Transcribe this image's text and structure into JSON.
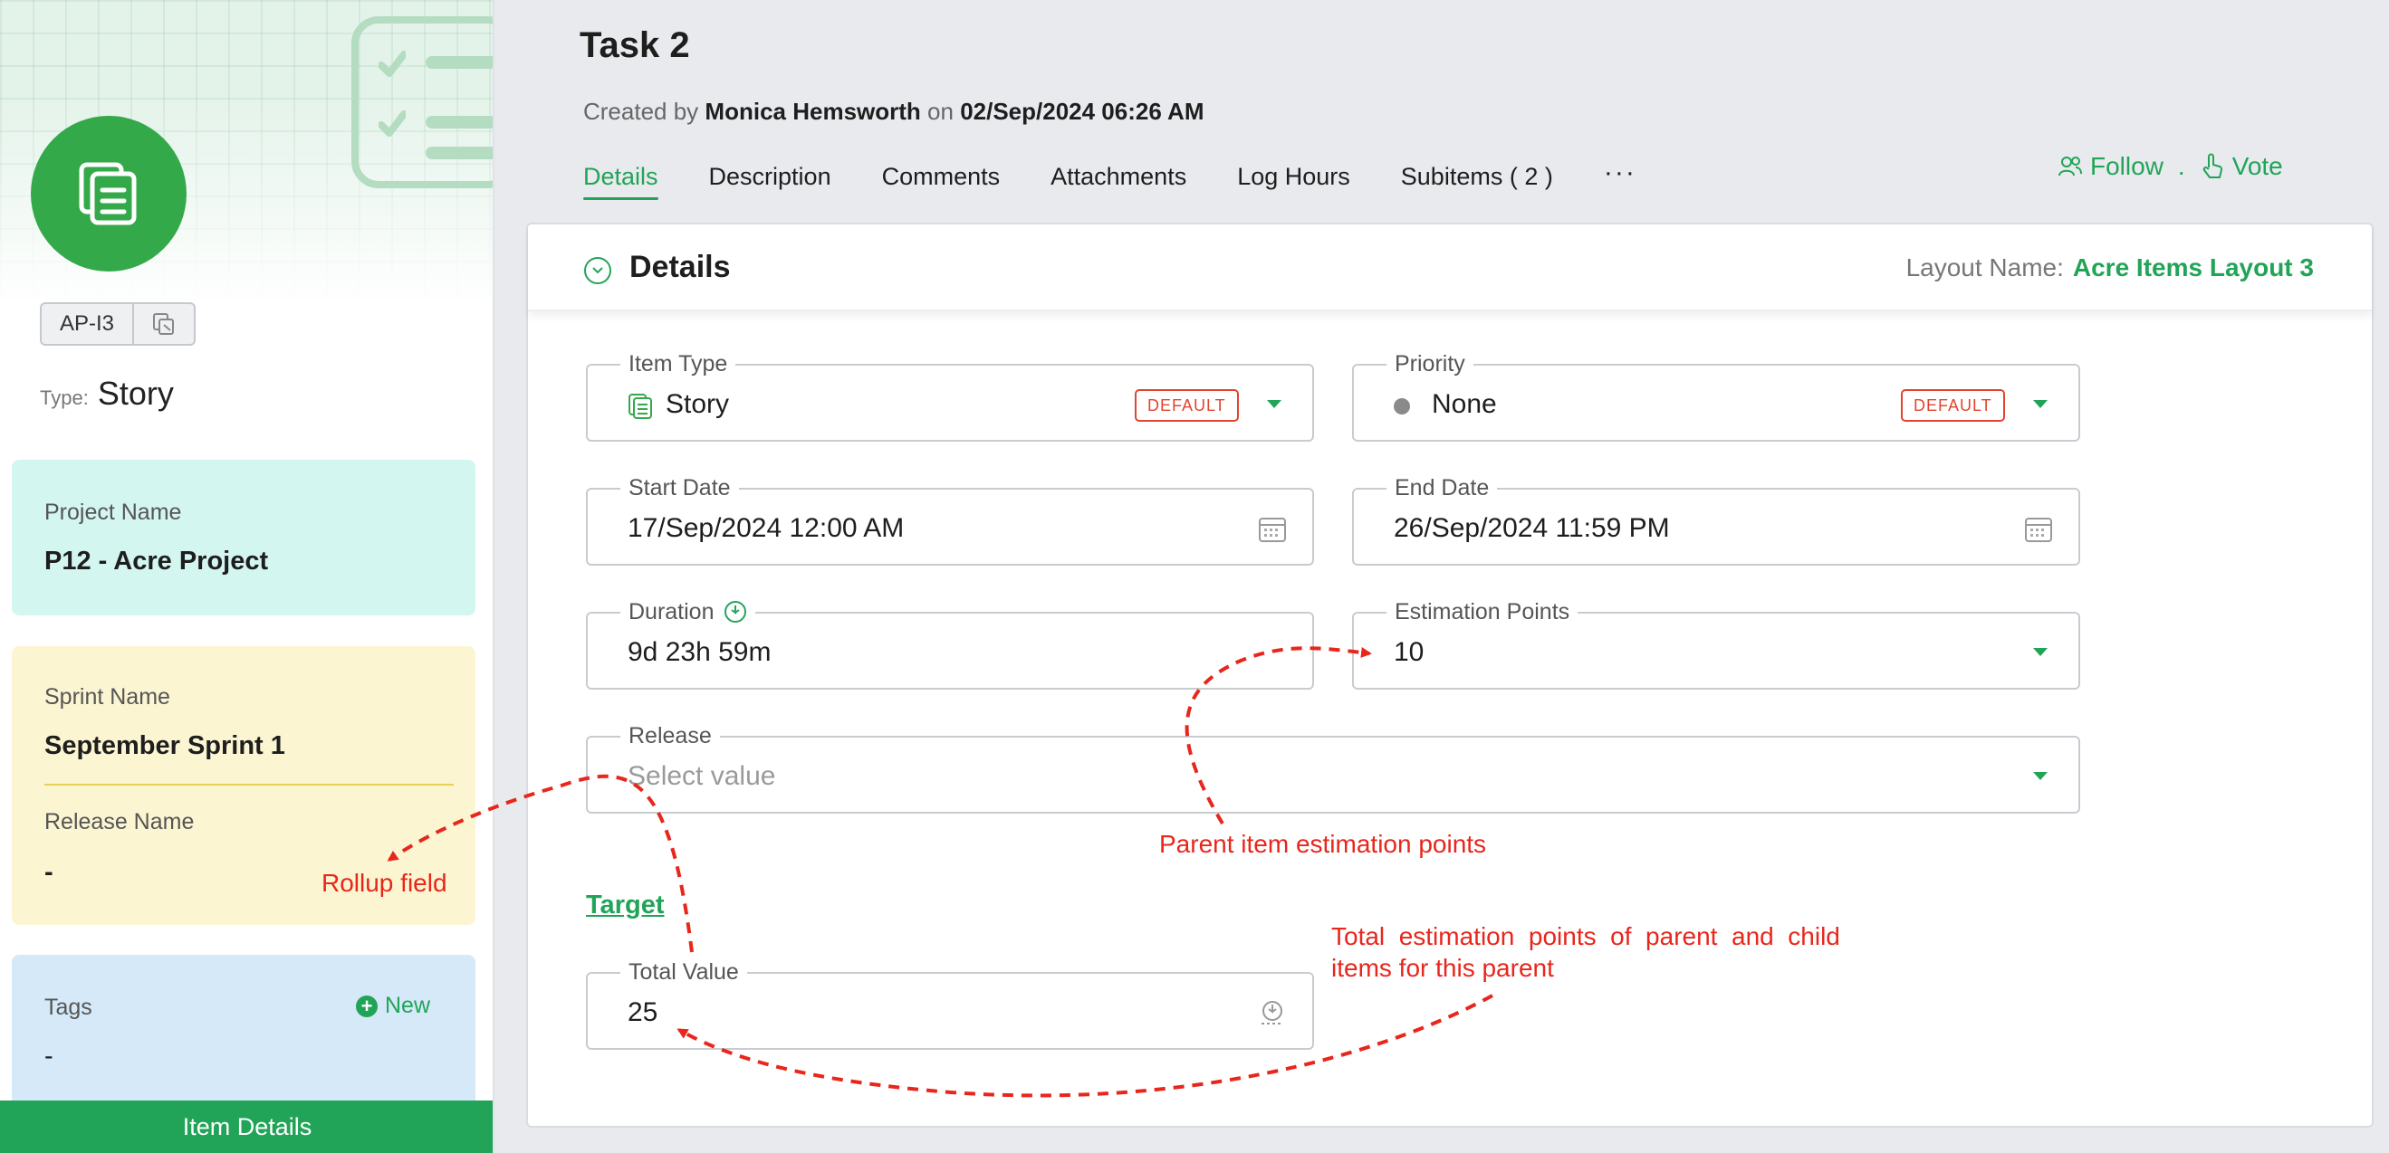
{
  "sidebar": {
    "item_id": "AP-I3",
    "type_label": "Type:",
    "type_value": "Story",
    "project": {
      "label": "Project Name",
      "value": "P12 - Acre Project"
    },
    "sprint": {
      "label": "Sprint Name",
      "value": "September Sprint 1"
    },
    "release": {
      "label": "Release Name",
      "value": "-"
    },
    "tags": {
      "label": "Tags",
      "value": "-",
      "new_label": "New"
    },
    "footer_label": "Item Details",
    "accent_color": "#22a458"
  },
  "header": {
    "title": "Task 2",
    "created_prefix": "Created by",
    "created_by": "Monica Hemsworth",
    "created_on_word": "on",
    "created_date": "02/Sep/2024 06:26 AM",
    "tabs": [
      {
        "label": "Details",
        "active": true
      },
      {
        "label": "Description"
      },
      {
        "label": "Comments"
      },
      {
        "label": "Attachments"
      },
      {
        "label": "Log Hours"
      },
      {
        "label": "Subitems  ( 2 )"
      }
    ],
    "more_label": "···",
    "follow_label": "Follow",
    "separator": ".",
    "vote_label": "Vote"
  },
  "panel": {
    "title": "Details",
    "layout_label": "Layout Name:",
    "layout_value": "Acre Items Layout 3",
    "fields": {
      "item_type": {
        "label": "Item Type",
        "value": "Story",
        "badge": "DEFAULT"
      },
      "priority": {
        "label": "Priority",
        "value": "None",
        "badge": "DEFAULT"
      },
      "start_date": {
        "label": "Start Date",
        "value": "17/Sep/2024 12:00 AM"
      },
      "end_date": {
        "label": "End Date",
        "value": "26/Sep/2024 11:59 PM"
      },
      "duration": {
        "label": "Duration",
        "value": "9d 23h 59m"
      },
      "estimation_points": {
        "label": "Estimation Points",
        "value": "10"
      },
      "release": {
        "label": "Release",
        "placeholder": "Select value"
      }
    },
    "target_section": "Target",
    "total_value": {
      "label": "Total Value",
      "value": "25"
    }
  },
  "annotations": {
    "rollup": "Rollup field",
    "parent_points": "Parent item estimation points",
    "total_points_line1": "Total  estimation  points  of  parent  and  child",
    "total_points_line2": "items for this parent",
    "color": "#e8261c"
  }
}
